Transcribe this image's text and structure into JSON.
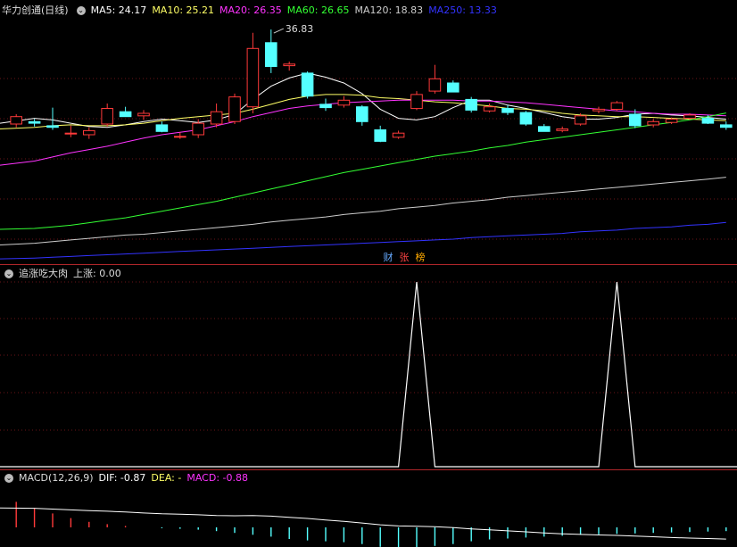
{
  "main": {
    "stock_name": "华力创通",
    "period": "(日线)",
    "ma": [
      {
        "label": "MA5: 24.17",
        "color": "#ffffff"
      },
      {
        "label": "MA10: 25.21",
        "color": "#ffff66"
      },
      {
        "label": "MA20: 26.35",
        "color": "#ff33ff"
      },
      {
        "label": "MA60: 26.65",
        "color": "#33ff33"
      },
      {
        "label": "MA120: 18.83",
        "color": "#cccccc"
      },
      {
        "label": "MA250: 13.33",
        "color": "#3333ff"
      }
    ],
    "high_marker": "36.83",
    "badges": [
      {
        "label": "财",
        "color": "#66aaff"
      },
      {
        "label": "张",
        "color": "#ff4444"
      },
      {
        "label": "榜",
        "color": "#ffaa00"
      }
    ]
  },
  "indicator": {
    "title": "追涨吃大肉",
    "value_label": "上涨: 0.00"
  },
  "macd": {
    "title": "MACD(12,26,9)",
    "dif": "DIF: -0.87",
    "dea": "DEA: -",
    "macd": "MACD: -0.88"
  },
  "chart_data": [
    {
      "type": "candlestick",
      "title": "华力创通 (日线)",
      "price_range": [
        10,
        38
      ],
      "candles": [
        {
          "o": 25.3,
          "h": 26.5,
          "l": 24.9,
          "c": 26.2
        },
        {
          "o": 25.6,
          "h": 25.9,
          "l": 25.0,
          "c": 25.4
        },
        {
          "o": 25.1,
          "h": 27.3,
          "l": 24.6,
          "c": 24.9
        },
        {
          "o": 24.2,
          "h": 25.1,
          "l": 23.7,
          "c": 24.2
        },
        {
          "o": 24.0,
          "h": 24.9,
          "l": 23.5,
          "c": 24.5
        },
        {
          "o": 25.3,
          "h": 27.8,
          "l": 25.0,
          "c": 27.2
        },
        {
          "o": 26.8,
          "h": 27.4,
          "l": 26.4,
          "c": 26.2
        },
        {
          "o": 26.3,
          "h": 27.0,
          "l": 25.8,
          "c": 26.6
        },
        {
          "o": 25.2,
          "h": 25.6,
          "l": 24.3,
          "c": 24.4
        },
        {
          "o": 23.8,
          "h": 24.3,
          "l": 23.5,
          "c": 23.8
        },
        {
          "o": 24.0,
          "h": 25.9,
          "l": 23.6,
          "c": 25.4
        },
        {
          "o": 25.3,
          "h": 27.8,
          "l": 24.9,
          "c": 26.8
        },
        {
          "o": 25.6,
          "h": 29.0,
          "l": 25.3,
          "c": 28.6
        },
        {
          "o": 27.4,
          "h": 36.4,
          "l": 26.6,
          "c": 34.5
        },
        {
          "o": 35.2,
          "h": 36.8,
          "l": 31.5,
          "c": 32.3
        },
        {
          "o": 32.4,
          "h": 32.9,
          "l": 31.8,
          "c": 32.6
        },
        {
          "o": 31.5,
          "h": 31.7,
          "l": 28.4,
          "c": 28.7
        },
        {
          "o": 27.7,
          "h": 28.4,
          "l": 26.9,
          "c": 27.3
        },
        {
          "o": 27.6,
          "h": 28.7,
          "l": 27.3,
          "c": 28.2
        },
        {
          "o": 27.4,
          "h": 27.6,
          "l": 25.1,
          "c": 25.6
        },
        {
          "o": 24.6,
          "h": 25.1,
          "l": 23.1,
          "c": 23.2
        },
        {
          "o": 23.7,
          "h": 24.5,
          "l": 23.5,
          "c": 24.2
        },
        {
          "o": 27.2,
          "h": 29.3,
          "l": 27.0,
          "c": 28.9
        },
        {
          "o": 29.3,
          "h": 32.5,
          "l": 29.0,
          "c": 30.8
        },
        {
          "o": 30.3,
          "h": 30.6,
          "l": 29.2,
          "c": 29.2
        },
        {
          "o": 28.3,
          "h": 28.6,
          "l": 26.7,
          "c": 27.0
        },
        {
          "o": 26.9,
          "h": 27.8,
          "l": 26.7,
          "c": 27.4
        },
        {
          "o": 27.2,
          "h": 27.6,
          "l": 26.4,
          "c": 26.7
        },
        {
          "o": 26.7,
          "h": 26.9,
          "l": 25.1,
          "c": 25.3
        },
        {
          "o": 25.0,
          "h": 25.3,
          "l": 24.4,
          "c": 24.4
        },
        {
          "o": 24.5,
          "h": 25.0,
          "l": 24.3,
          "c": 24.7
        },
        {
          "o": 25.3,
          "h": 26.6,
          "l": 25.1,
          "c": 26.3
        },
        {
          "o": 26.9,
          "h": 27.4,
          "l": 26.6,
          "c": 27.1
        },
        {
          "o": 27.1,
          "h": 28.1,
          "l": 26.9,
          "c": 27.9
        },
        {
          "o": 26.5,
          "h": 27.1,
          "l": 24.8,
          "c": 25.1
        },
        {
          "o": 25.2,
          "h": 25.9,
          "l": 24.9,
          "c": 25.6
        },
        {
          "o": 25.5,
          "h": 26.1,
          "l": 25.3,
          "c": 25.9
        },
        {
          "o": 26.0,
          "h": 26.6,
          "l": 25.8,
          "c": 26.4
        },
        {
          "o": 26.0,
          "h": 26.4,
          "l": 25.3,
          "c": 25.4
        },
        {
          "o": 25.2,
          "h": 25.6,
          "l": 24.6,
          "c": 24.9
        }
      ],
      "ma_series": [
        {
          "name": "MA5",
          "values": [
            25.4,
            26.0,
            25.8,
            25.4,
            25.0,
            24.9,
            25.2,
            25.6,
            25.9,
            25.7,
            25.5,
            25.8,
            26.5,
            28.3,
            29.9,
            30.9,
            31.5,
            31.0,
            30.3,
            29.0,
            27.1,
            26.0,
            25.8,
            26.2,
            27.3,
            28.2,
            28.2,
            27.6,
            27.2,
            26.7,
            26.2,
            25.9,
            25.9,
            26.1,
            26.5,
            26.6,
            26.4,
            26.3,
            26.1,
            25.9
          ]
        },
        {
          "name": "MA10",
          "values": [
            24.7,
            24.9,
            25.1,
            25.2,
            25.1,
            25.1,
            25.2,
            25.4,
            25.7,
            26.0,
            26.2,
            26.4,
            26.6,
            27.1,
            27.7,
            28.3,
            28.7,
            28.9,
            28.9,
            28.8,
            28.5,
            28.4,
            28.2,
            28.0,
            27.9,
            27.7,
            27.5,
            27.2,
            27.1,
            26.9,
            26.6,
            26.4,
            26.3,
            26.2,
            26.2,
            26.1,
            26.0,
            25.9,
            25.8,
            25.7
          ]
        },
        {
          "name": "MA20",
          "values": [
            20.3,
            20.8,
            21.3,
            21.8,
            22.2,
            22.6,
            23.1,
            23.6,
            24.0,
            24.3,
            24.6,
            25.1,
            25.6,
            26.2,
            26.7,
            27.2,
            27.5,
            27.7,
            27.9,
            28.0,
            28.1,
            28.2,
            28.2,
            28.2,
            28.2,
            28.1,
            28.1,
            28.0,
            27.9,
            27.7,
            27.5,
            27.3,
            27.1,
            26.9,
            26.8,
            26.6,
            26.5,
            26.5,
            26.4,
            26.3
          ]
        },
        {
          "name": "MA60",
          "values": [
            12.5,
            12.6,
            12.8,
            13.0,
            13.3,
            13.6,
            13.9,
            14.3,
            14.7,
            15.1,
            15.5,
            15.9,
            16.4,
            16.9,
            17.4,
            17.9,
            18.4,
            18.9,
            19.4,
            19.8,
            20.2,
            20.6,
            21.0,
            21.4,
            21.7,
            22.0,
            22.4,
            22.7,
            23.1,
            23.4,
            23.7,
            24.0,
            24.3,
            24.6,
            24.9,
            25.2,
            25.5,
            25.8,
            26.2,
            26.65
          ]
        },
        {
          "name": "MA120",
          "values": [
            10.6,
            10.8,
            11.0,
            11.2,
            11.4,
            11.6,
            11.8,
            11.9,
            12.1,
            12.3,
            12.5,
            12.7,
            12.9,
            13.1,
            13.4,
            13.6,
            13.8,
            14.0,
            14.3,
            14.5,
            14.7,
            15.0,
            15.2,
            15.4,
            15.7,
            15.9,
            16.1,
            16.4,
            16.6,
            16.8,
            17.0,
            17.2,
            17.4,
            17.6,
            17.8,
            18.0,
            18.2,
            18.4,
            18.6,
            18.83
          ]
        },
        {
          "name": "MA250",
          "values": [
            8.9,
            9.0,
            9.1,
            9.2,
            9.3,
            9.4,
            9.5,
            9.6,
            9.7,
            9.8,
            9.9,
            10.0,
            10.1,
            10.2,
            10.3,
            10.4,
            10.5,
            10.6,
            10.7,
            10.8,
            10.9,
            11.0,
            11.1,
            11.2,
            11.3,
            11.5,
            11.6,
            11.7,
            11.8,
            11.9,
            12.0,
            12.2,
            12.3,
            12.4,
            12.6,
            12.7,
            12.8,
            13.0,
            13.1,
            13.33
          ]
        }
      ]
    },
    {
      "type": "line",
      "title": "追涨吃大肉",
      "series": [
        {
          "name": "上涨",
          "spikes_at_index": [
            22,
            33
          ]
        }
      ],
      "ylim": [
        0,
        1
      ]
    },
    {
      "type": "bar",
      "title": "MACD(12,26,9)",
      "dif": [
        0.72,
        0.7,
        0.66,
        0.62,
        0.58,
        0.55,
        0.51,
        0.46,
        0.42,
        0.4,
        0.37,
        0.33,
        0.32,
        0.33,
        0.3,
        0.24,
        0.18,
        0.1,
        0.03,
        -0.05,
        -0.14,
        -0.2,
        -0.22,
        -0.24,
        -0.28,
        -0.35,
        -0.4,
        -0.45,
        -0.5,
        -0.56,
        -0.6,
        -0.63,
        -0.66,
        -0.68,
        -0.72,
        -0.75,
        -0.79,
        -0.82,
        -0.84,
        -0.87
      ],
      "macd_hist": [
        0.55,
        0.42,
        0.3,
        0.2,
        0.12,
        0.07,
        0.03,
        0.0,
        -0.02,
        -0.03,
        -0.05,
        -0.08,
        -0.12,
        -0.16,
        -0.2,
        -0.25,
        -0.28,
        -0.3,
        -0.32,
        -0.36,
        -0.42,
        -0.48,
        -0.46,
        -0.4,
        -0.36,
        -0.3,
        -0.26,
        -0.24,
        -0.22,
        -0.2,
        -0.18,
        -0.16,
        -0.15,
        -0.14,
        -0.13,
        -0.12,
        -0.11,
        -0.1,
        -0.09,
        -0.08
      ]
    }
  ]
}
